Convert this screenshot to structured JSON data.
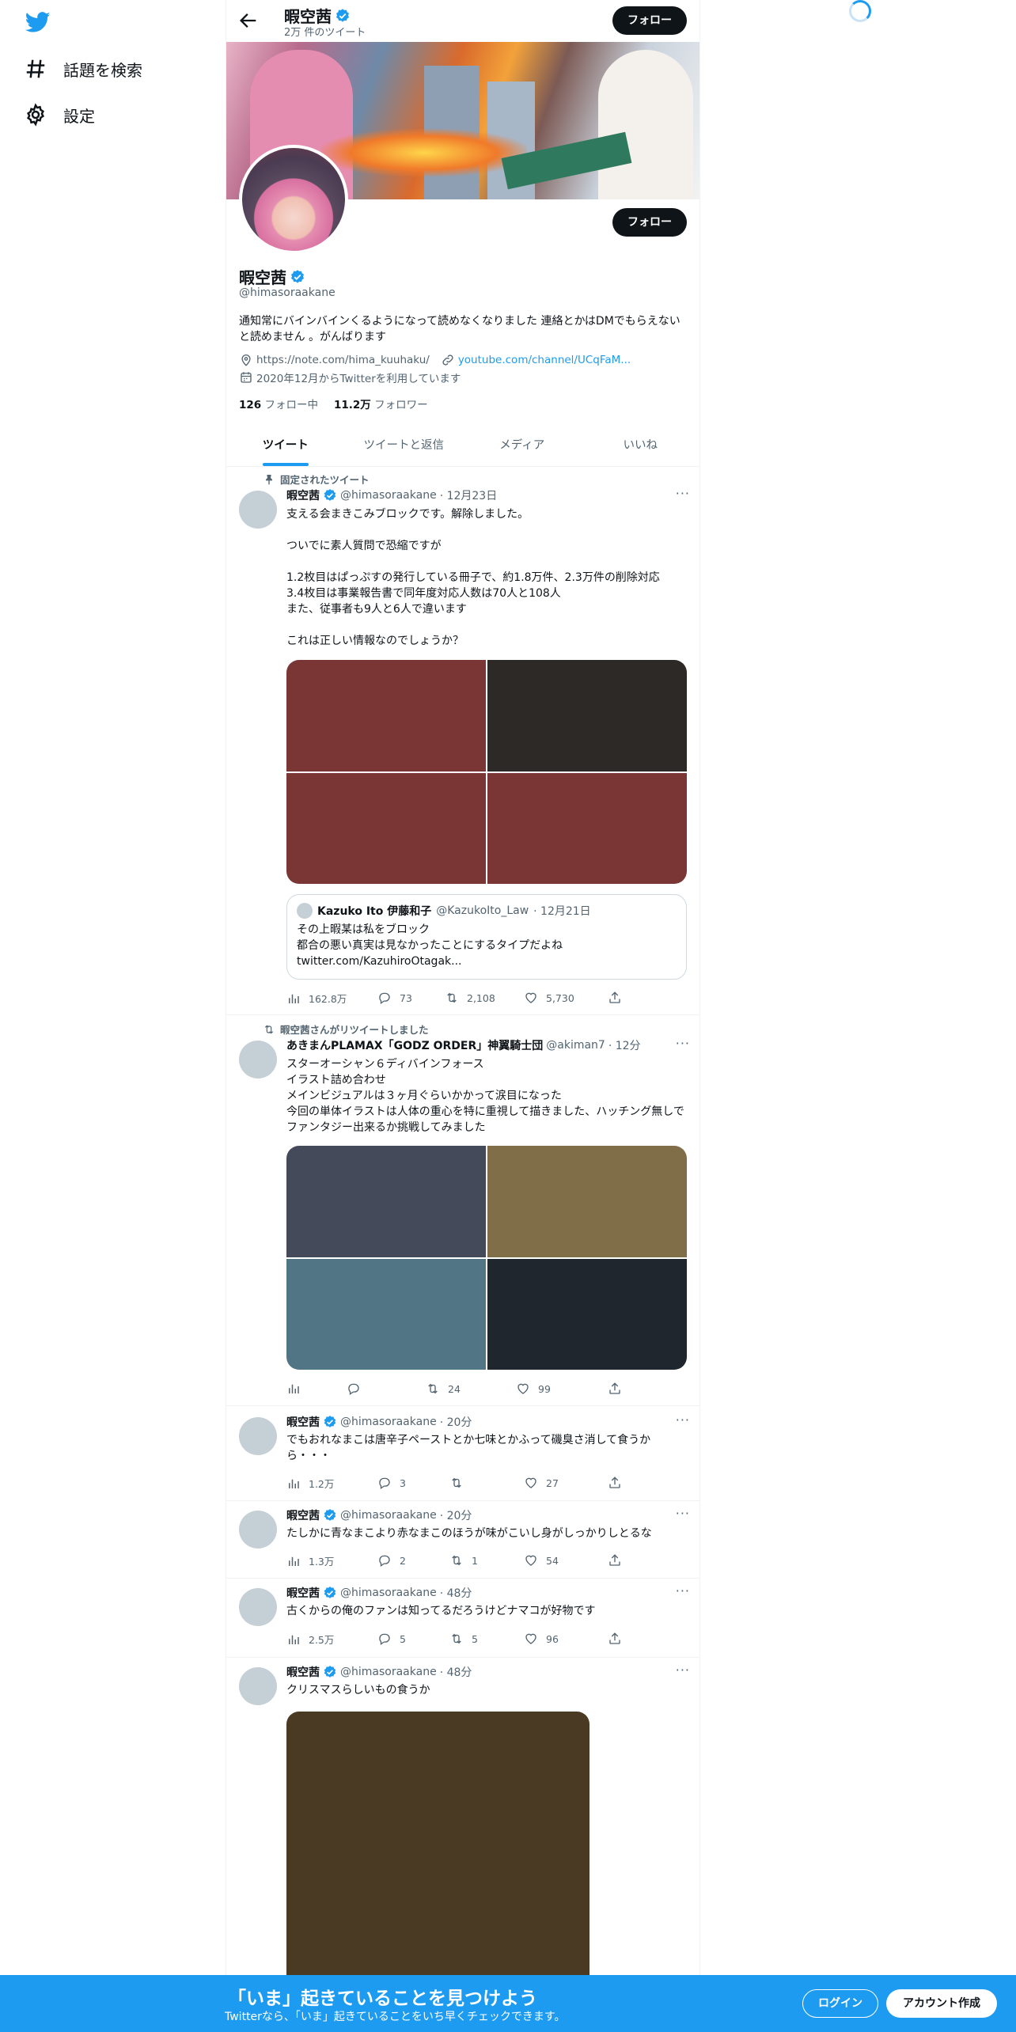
{
  "nav": {
    "explore_label": "話題を検索",
    "settings_label": "設定"
  },
  "topbar": {
    "name": "暇空茜",
    "tweet_count": "2万 件のツイート",
    "follow_label": "フォロー"
  },
  "profile": {
    "name": "暇空茜",
    "handle": "@himasoraakane",
    "bio": "通知常にバインバインくるようになって読めなくなりました 連絡とかはDMでもらえないと読めません 。がんばります",
    "location": "https://note.com/hima_kuuhaku/",
    "link": "youtube.com/channel/UCqFaM...",
    "joined": "2020年12月からTwitterを利用しています",
    "following_count": "126",
    "following_label": "フォロー中",
    "followers_count": "11.2万",
    "followers_label": "フォロワー",
    "follow_label": "フォロー"
  },
  "tabs": [
    "ツイート",
    "ツイートと返信",
    "メディア",
    "いいね"
  ],
  "tweets": [
    {
      "social": "固定されたツイート",
      "name": "暇空茜",
      "handle": "@himasoraakane",
      "time": "· 12月23日",
      "text": "支える会まきこみブロックです。解除しました。\n\nついでに素人質問で恐縮ですが\n\n1.2枚目はぱっぷすの発行している冊子で、約1.8万件、2.3万件の削除対応\n3.4枚目は事業報告書で同年度対応人数は70人と108人\nまた、従事者も9人と6人で違います\n\nこれは正しい情報なのでしょうか？",
      "media_colors": [
        "#7a3535",
        "#2d2927",
        "#7a3535",
        "#7a3535"
      ],
      "quote": {
        "name": "Kazuko Ito 伊藤和子",
        "handle": "@KazukoIto_Law",
        "time": "· 12月21日",
        "text": "その上暇某は私をブロック\n都合の悪い真実は見なかったことにするタイプだよね\ntwitter.com/KazuhiroOtagak..."
      },
      "views": "162.8万",
      "replies": "73",
      "retweets": "2,108",
      "likes": "5,730"
    },
    {
      "social": "暇空茜さんがリツイートしました",
      "name": "あきまんPLAMAX「GODZ ORDER」神翼騎士団",
      "handle": "@akiman7",
      "time": "· 12分",
      "text": "スターオーシャン６ディバインフォース\nイラスト詰め合わせ\nメインビジュアルは３ヶ月ぐらいかかって涙目になった\n今回の単体イラストは人体の重心を特に重視して描きました、ハッチング無しでファンタジー出来るか挑戦してみました",
      "media_colors": [
        "#454a5a",
        "#7f6e48",
        "#527585",
        "#20262d"
      ],
      "views": "",
      "replies": "",
      "retweets": "24",
      "likes": "99"
    },
    {
      "name": "暇空茜",
      "handle": "@himasoraakane",
      "time": "· 20分",
      "text": "でもおれなまこは唐辛子ペーストとか七味とかふって磯臭さ消して食うから・・・",
      "views": "1.2万",
      "replies": "3",
      "retweets": "",
      "likes": "27"
    },
    {
      "name": "暇空茜",
      "handle": "@himasoraakane",
      "time": "· 20分",
      "text": "たしかに青なまこより赤なまこのほうが味がこいし身がしっかりしとるな",
      "views": "1.3万",
      "replies": "2",
      "retweets": "1",
      "likes": "54"
    },
    {
      "name": "暇空茜",
      "handle": "@himasoraakane",
      "time": "· 48分",
      "text": "古くからの俺のファンは知ってるだろうけどナマコが好物です",
      "views": "2.5万",
      "replies": "5",
      "retweets": "5",
      "likes": "96"
    },
    {
      "name": "暇空茜",
      "handle": "@himasoraakane",
      "time": "· 48分",
      "text": "クリスマスらしいもの食うか",
      "media_color": "#4a3a24"
    }
  ],
  "bottombar": {
    "title": "「いま」起きていることを見つけよう",
    "subtitle": "Twitterなら、「いま」起きていることをいち早くチェックできます。",
    "login": "ログイン",
    "signup": "アカウント作成"
  },
  "colors": {
    "accent": "#1d9bf0",
    "dark": "#0f1419",
    "muted": "#536471"
  }
}
